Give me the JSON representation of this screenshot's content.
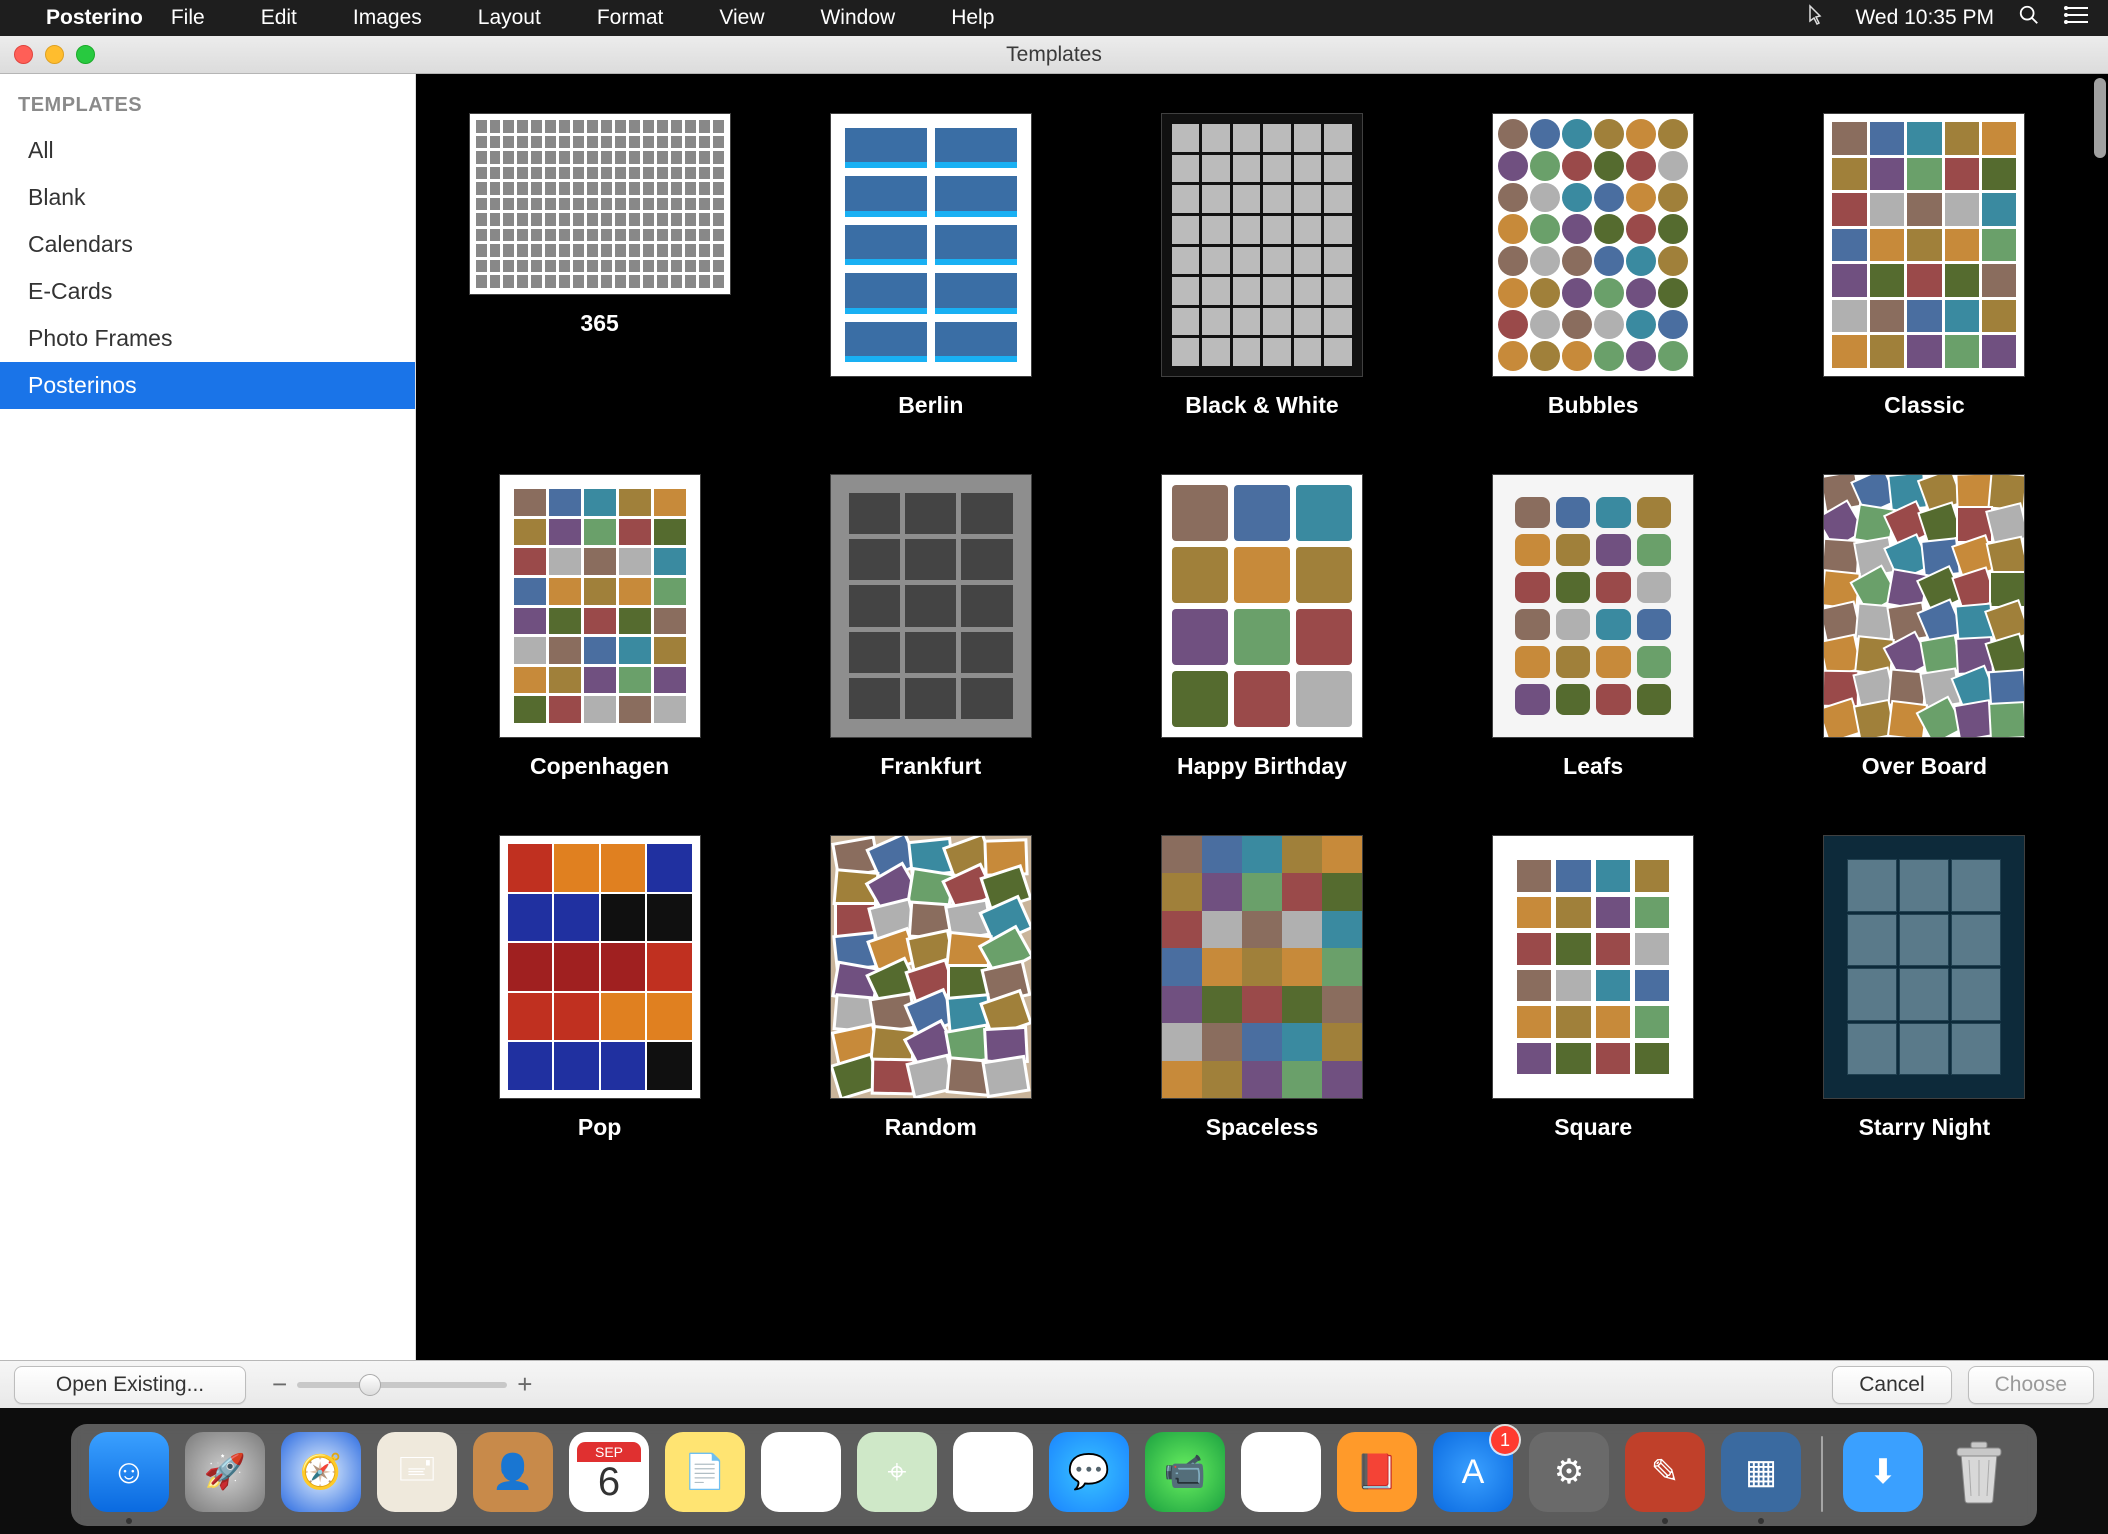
{
  "menubar": {
    "app": "Posterino",
    "items": [
      "File",
      "Edit",
      "Images",
      "Layout",
      "Format",
      "View",
      "Window",
      "Help"
    ],
    "clock": "Wed 10:35 PM"
  },
  "window": {
    "title": "Templates"
  },
  "sidebar": {
    "section": "TEMPLATES",
    "items": [
      {
        "label": "All",
        "selected": false
      },
      {
        "label": "Blank",
        "selected": false
      },
      {
        "label": "Calendars",
        "selected": false
      },
      {
        "label": "E-Cards",
        "selected": false
      },
      {
        "label": "Photo Frames",
        "selected": false
      },
      {
        "label": "Posterinos",
        "selected": true
      }
    ]
  },
  "templates": [
    {
      "name": "365",
      "orientation": "landscape",
      "style": "t-365"
    },
    {
      "name": "Berlin",
      "orientation": "portrait",
      "style": "t-berlin"
    },
    {
      "name": "Black & White",
      "orientation": "portrait",
      "style": "t-bw",
      "thumbClass": "bw"
    },
    {
      "name": "Bubbles",
      "orientation": "portrait",
      "style": "t-bubbles",
      "thumbClass": "bubbles"
    },
    {
      "name": "Classic",
      "orientation": "portrait",
      "style": "t-classic"
    },
    {
      "name": "Copenhagen",
      "orientation": "portrait",
      "style": "t-copen"
    },
    {
      "name": "Frankfurt",
      "orientation": "portrait",
      "style": "t-frank",
      "thumbClass": "frankfurt"
    },
    {
      "name": "Happy Birthday",
      "orientation": "portrait",
      "style": "t-hb",
      "thumbClass": "hb"
    },
    {
      "name": "Leafs",
      "orientation": "portrait",
      "style": "t-leafs",
      "thumbClass": "leafs"
    },
    {
      "name": "Over Board",
      "orientation": "portrait",
      "style": "t-over"
    },
    {
      "name": "Pop",
      "orientation": "portrait",
      "style": "t-pop",
      "thumbClass": "pop"
    },
    {
      "name": "Random",
      "orientation": "portrait",
      "style": "t-random",
      "thumbClass": "random"
    },
    {
      "name": "Spaceless",
      "orientation": "portrait",
      "style": "t-spaceless"
    },
    {
      "name": "Square",
      "orientation": "portrait",
      "style": "t-square",
      "thumbClass": "square"
    },
    {
      "name": "Starry Night",
      "orientation": "portrait",
      "style": "t-starry",
      "thumbClass": "starry"
    }
  ],
  "footer": {
    "open_existing": "Open Existing...",
    "cancel": "Cancel",
    "choose": "Choose",
    "choose_enabled": false
  },
  "dock": {
    "calendar": {
      "month": "SEP",
      "day": "6"
    },
    "appstore_badge": "1",
    "items_left": [
      {
        "name": "finder",
        "cls": "i-finder",
        "running": true,
        "glyph": "☺"
      },
      {
        "name": "launchpad",
        "cls": "i-launch",
        "running": false,
        "glyph": "🚀"
      },
      {
        "name": "safari",
        "cls": "i-safari",
        "running": false,
        "glyph": "🧭"
      },
      {
        "name": "mail",
        "cls": "i-mail",
        "running": false,
        "glyph": "🖃"
      },
      {
        "name": "contacts",
        "cls": "i-contacts",
        "running": false,
        "glyph": "👤"
      },
      {
        "name": "calendar",
        "cls": "i-cal",
        "running": false,
        "glyph": "CAL"
      },
      {
        "name": "notes",
        "cls": "i-notes",
        "running": false,
        "glyph": "📄"
      },
      {
        "name": "reminders",
        "cls": "i-rem",
        "running": false,
        "glyph": "☑"
      },
      {
        "name": "maps",
        "cls": "i-maps",
        "running": false,
        "glyph": "⌖"
      },
      {
        "name": "photos",
        "cls": "i-photos",
        "running": false,
        "glyph": "✿"
      },
      {
        "name": "messages",
        "cls": "i-msg",
        "running": false,
        "glyph": "💬"
      },
      {
        "name": "facetime",
        "cls": "i-ft",
        "running": false,
        "glyph": "📹"
      },
      {
        "name": "itunes",
        "cls": "i-itunes",
        "running": false,
        "glyph": "♪"
      },
      {
        "name": "ibooks",
        "cls": "i-ibooks",
        "running": false,
        "glyph": "📕"
      },
      {
        "name": "appstore",
        "cls": "i-appstore",
        "running": false,
        "glyph": "A",
        "badge": true
      },
      {
        "name": "preferences",
        "cls": "i-pref",
        "running": false,
        "glyph": "⚙"
      },
      {
        "name": "xscope",
        "cls": "i-xscope",
        "running": true,
        "glyph": "✎"
      },
      {
        "name": "posterino",
        "cls": "i-poster",
        "running": true,
        "glyph": "▦"
      }
    ],
    "items_right": [
      {
        "name": "downloads",
        "cls": "i-dl",
        "glyph": "⬇"
      },
      {
        "name": "trash",
        "cls": "i-trash",
        "glyph": "TRASH"
      }
    ]
  }
}
